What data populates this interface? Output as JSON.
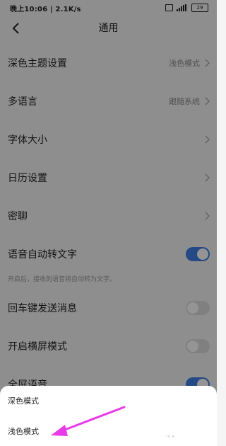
{
  "status_bar": {
    "time_speed": "晚上10:06 | 2.1K/s",
    "battery": "29"
  },
  "header": {
    "title": "通用"
  },
  "settings": {
    "dark_theme": {
      "label": "深色主题设置",
      "value": "浅色模式"
    },
    "language": {
      "label": "多语言",
      "value": "跟随系统"
    },
    "font_size": {
      "label": "字体大小"
    },
    "calendar": {
      "label": "日历设置"
    },
    "secret_chat": {
      "label": "密聊"
    },
    "voice_to_text": {
      "label": "语音自动转文字",
      "on": true,
      "hint": "开启后，接收的语音将自动转为文字。"
    },
    "enter_send": {
      "label": "回车键发送消息",
      "on": false
    },
    "landscape": {
      "label": "开启横屏模式",
      "on": false
    },
    "full_voice": {
      "label": "全屏语音",
      "on": true
    }
  },
  "bottom_sheet": {
    "options": [
      "深色模式",
      "浅色模式"
    ]
  },
  "colors": {
    "accent": "#3f7fe6",
    "annotation": "#e83ae8"
  }
}
